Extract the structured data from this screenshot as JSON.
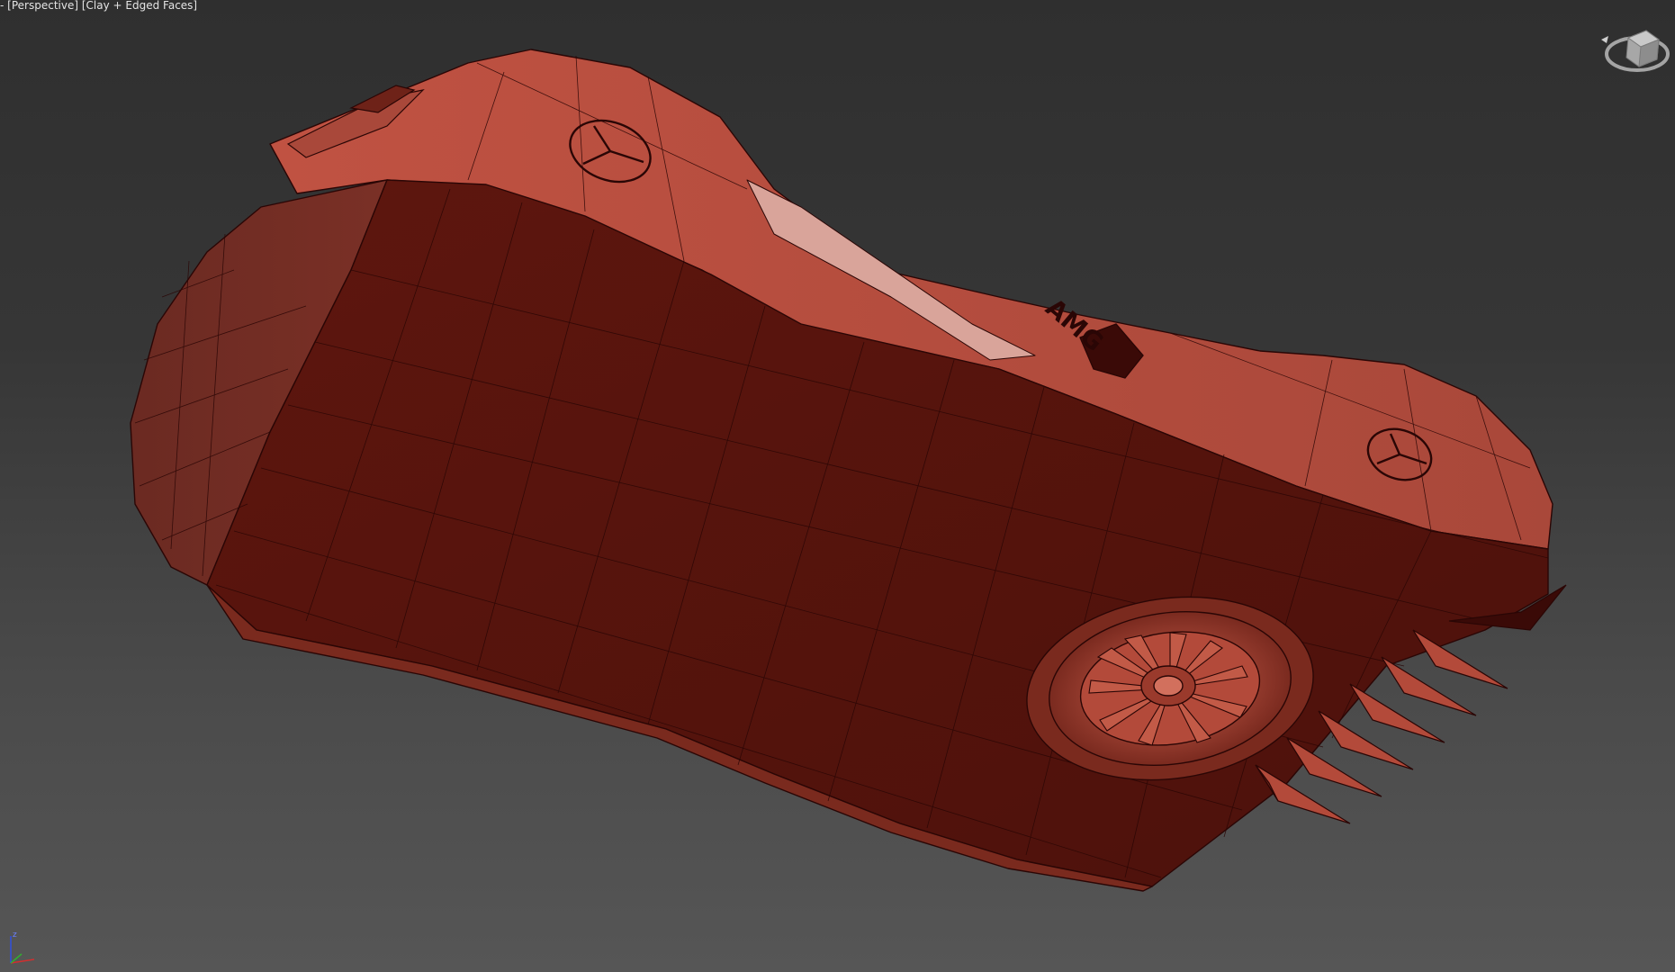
{
  "viewport": {
    "menu_label": "-",
    "view_label": "[Perspective]",
    "shading_label": "[Clay + Edged Faces]"
  },
  "model": {
    "badge_text": "AMG",
    "logo_icon": "mercedes-star-icon"
  },
  "colors": {
    "background_top": "#2f2f2f",
    "background_bottom": "#565656",
    "clay_side": "#5a150e",
    "clay_top": "#b34a3a",
    "wire_edge": "#2a0605",
    "axis_x": "#d03030",
    "axis_y": "#30b030",
    "axis_z": "#3050e0"
  },
  "navigation": {
    "viewcube_icon": "viewcube-icon",
    "axis_icon": "axis-tripod-icon"
  }
}
